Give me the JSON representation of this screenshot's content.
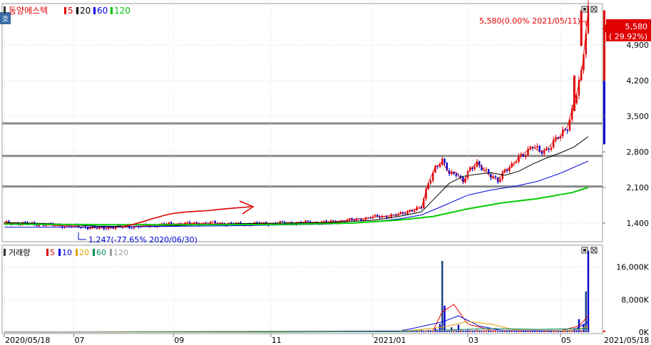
{
  "price_panel": {
    "title": "동양에스텍",
    "ma_legend": [
      {
        "label": "5",
        "color": "#e00000"
      },
      {
        "label": "20",
        "color": "#000000"
      },
      {
        "label": "60",
        "color": "#0000e0"
      },
      {
        "label": "120",
        "color": "#00c000"
      }
    ],
    "corner_label": "호",
    "high_annotation": "5,580(0.00% 2021/05/11)",
    "low_annotation": "1,247(-77.65% 2020/06/30)",
    "current_price": "5,580",
    "current_change": "( 29.92%)"
  },
  "volume_panel": {
    "title": "거래량",
    "ma_legend": [
      {
        "label": "5",
        "color": "#e00000"
      },
      {
        "label": "10",
        "color": "#0000e0"
      },
      {
        "label": "20",
        "color": "#e0a000"
      },
      {
        "label": "60",
        "color": "#009060"
      },
      {
        "label": "120",
        "color": "#a0a0a0"
      }
    ]
  },
  "x_axis_labels": [
    "2020/05/18",
    "07",
    "09",
    "11",
    "2021/01",
    "03",
    "05",
    "2021/05/18"
  ],
  "colors": {
    "up": "#e00000",
    "down": "#0000d0",
    "ma5": "#e00000",
    "ma20": "#000000",
    "ma60": "#0000e0",
    "ma120": "#00cc00",
    "annotation": "#e00000"
  },
  "chart_data": [
    {
      "type": "candlestick",
      "title": "동양에스텍",
      "x_range": [
        "2020/05/18",
        "2021/05/18"
      ],
      "y_ticks": [
        1400,
        2100,
        2800,
        3500,
        4200,
        4900
      ],
      "y_tick_labels": [
        "1,400",
        "2,100",
        "2,800",
        "3,500",
        "4,200",
        "4,900"
      ],
      "ylim": [
        1050,
        5700
      ],
      "horizontal_lines": [
        2120,
        2720,
        3360
      ],
      "series": [
        {
          "name": "5",
          "values": [
            [
              0,
              1400
            ],
            [
              10,
              1390
            ],
            [
              20,
              1360
            ],
            [
              30,
              1340
            ],
            [
              40,
              1300
            ],
            [
              50,
              1320
            ],
            [
              60,
              1340
            ],
            [
              70,
              1380
            ],
            [
              80,
              1390
            ],
            [
              90,
              1400
            ],
            [
              100,
              1380
            ],
            [
              110,
              1390
            ],
            [
              120,
              1400
            ],
            [
              130,
              1410
            ],
            [
              140,
              1420
            ],
            [
              150,
              1460
            ],
            [
              160,
              1520
            ],
            [
              170,
              1560
            ],
            [
              175,
              1650
            ],
            [
              180,
              1700
            ],
            [
              183,
              2200
            ],
            [
              186,
              2500
            ],
            [
              189,
              2600
            ],
            [
              192,
              2380
            ],
            [
              195,
              2400
            ],
            [
              198,
              2200
            ],
            [
              201,
              2450
            ],
            [
              204,
              2600
            ],
            [
              207,
              2450
            ],
            [
              210,
              2300
            ],
            [
              213,
              2250
            ],
            [
              216,
              2450
            ],
            [
              219,
              2500
            ],
            [
              222,
              2700
            ],
            [
              225,
              2800
            ],
            [
              228,
              2900
            ],
            [
              231,
              2800
            ],
            [
              234,
              2850
            ],
            [
              237,
              3000
            ],
            [
              240,
              3100
            ],
            [
              243,
              3300
            ],
            [
              246,
              3800
            ],
            [
              249,
              4300
            ],
            [
              252,
              5580
            ]
          ]
        },
        {
          "name": "20",
          "values": [
            [
              0,
              1410
            ],
            [
              20,
              1390
            ],
            [
              40,
              1340
            ],
            [
              60,
              1330
            ],
            [
              80,
              1360
            ],
            [
              100,
              1390
            ],
            [
              120,
              1400
            ],
            [
              140,
              1410
            ],
            [
              160,
              1460
            ],
            [
              170,
              1530
            ],
            [
              180,
              1620
            ],
            [
              186,
              1900
            ],
            [
              192,
              2180
            ],
            [
              198,
              2320
            ],
            [
              204,
              2360
            ],
            [
              210,
              2390
            ],
            [
              216,
              2340
            ],
            [
              222,
              2420
            ],
            [
              228,
              2560
            ],
            [
              234,
              2680
            ],
            [
              240,
              2780
            ],
            [
              246,
              2900
            ],
            [
              252,
              3100
            ]
          ]
        },
        {
          "name": "60",
          "values": [
            [
              0,
              1320
            ],
            [
              30,
              1320
            ],
            [
              60,
              1330
            ],
            [
              100,
              1350
            ],
            [
              140,
              1380
            ],
            [
              160,
              1430
            ],
            [
              170,
              1480
            ],
            [
              180,
              1560
            ],
            [
              190,
              1750
            ],
            [
              200,
              1950
            ],
            [
              210,
              2050
            ],
            [
              220,
              2120
            ],
            [
              230,
              2220
            ],
            [
              240,
              2380
            ],
            [
              252,
              2620
            ]
          ]
        },
        {
          "name": "120",
          "values": [
            [
              0,
              1380
            ],
            [
              40,
              1370
            ],
            [
              80,
              1370
            ],
            [
              120,
              1375
            ],
            [
              150,
              1400
            ],
            [
              170,
              1460
            ],
            [
              185,
              1530
            ],
            [
              200,
              1680
            ],
            [
              215,
              1800
            ],
            [
              230,
              1880
            ],
            [
              245,
              2000
            ],
            [
              252,
              2100
            ]
          ]
        }
      ],
      "annotations": [
        {
          "text": "5,580(0.00% 2021/05/11)",
          "x": 249,
          "y": 5580
        },
        {
          "text": "1,247(-77.65% 2020/06/30)",
          "x": 32,
          "y": 1247
        }
      ],
      "current": {
        "price": 5580,
        "change_pct": 29.92
      }
    },
    {
      "type": "bar",
      "title": "거래량",
      "y_ticks": [
        0,
        8000,
        16000
      ],
      "y_tick_labels": [
        "0K",
        "8,000K",
        "16,000K"
      ],
      "ylim": [
        0,
        21000
      ],
      "spikes": [
        [
          172,
          600
        ],
        [
          178,
          500
        ],
        [
          186,
          900
        ],
        [
          188,
          2000
        ],
        [
          189,
          17500
        ],
        [
          190,
          6500
        ],
        [
          193,
          1200
        ],
        [
          196,
          1800
        ],
        [
          200,
          700
        ],
        [
          205,
          500
        ],
        [
          215,
          600
        ],
        [
          240,
          400
        ],
        [
          246,
          900
        ],
        [
          248,
          3200
        ],
        [
          250,
          2000
        ],
        [
          251,
          10000
        ],
        [
          252,
          20000
        ]
      ],
      "series": [
        {
          "name": "5",
          "values": [
            [
              0,
              50
            ],
            [
              120,
              50
            ],
            [
              170,
              200
            ],
            [
              185,
              400
            ],
            [
              189,
              5000
            ],
            [
              194,
              6800
            ],
            [
              200,
              2000
            ],
            [
              210,
              500
            ],
            [
              240,
              400
            ],
            [
              248,
              1500
            ],
            [
              252,
              4000
            ]
          ]
        },
        {
          "name": "10",
          "values": [
            [
              0,
              50
            ],
            [
              170,
              150
            ],
            [
              189,
              2500
            ],
            [
              196,
              4000
            ],
            [
              205,
              1500
            ],
            [
              215,
              400
            ],
            [
              245,
              300
            ],
            [
              252,
              2500
            ]
          ]
        },
        {
          "name": "20",
          "values": [
            [
              0,
              60
            ],
            [
              110,
              60
            ],
            [
              170,
              100
            ],
            [
              189,
              1200
            ],
            [
              200,
              2600
            ],
            [
              210,
              2000
            ],
            [
              220,
              600
            ],
            [
              245,
              300
            ],
            [
              252,
              1400
            ]
          ]
        },
        {
          "name": "60",
          "values": [
            [
              0,
              60
            ],
            [
              170,
              80
            ],
            [
              189,
              500
            ],
            [
              210,
              900
            ],
            [
              230,
              700
            ],
            [
              252,
              900
            ]
          ]
        },
        {
          "name": "120",
          "values": [
            [
              0,
              60
            ],
            [
              252,
              500
            ]
          ]
        }
      ]
    }
  ]
}
